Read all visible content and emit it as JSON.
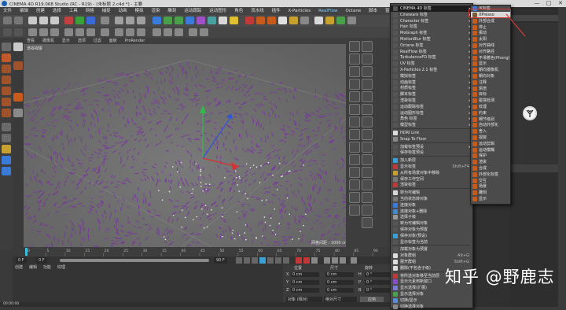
{
  "window": {
    "title": "CINEMA 4D R19.068 Studio (RC - R19) - [未标题 2.c4d *] - 主要",
    "controls": [
      "—",
      "□",
      "✕"
    ]
  },
  "menubar": {
    "items": [
      "文件",
      "编辑",
      "创建",
      "选择",
      "工具",
      "网格",
      "捕捉",
      "动画",
      "模拟",
      "渲染",
      "雕刻",
      "运动跟踪",
      "运动图形",
      "角色",
      "流水线",
      "插件",
      "X-Particles",
      "RealFlow",
      "Octane",
      "脚本",
      "窗口",
      "帮助"
    ]
  },
  "viewport": {
    "header_items": [
      "查看",
      "摄像机",
      "显示",
      "选项",
      "过滤",
      "面板",
      "ProRender"
    ],
    "tag": "透视视图",
    "grid_info": "网格间距 : 1000 cm",
    "scene_color": "#7b2fa5"
  },
  "timeline": {
    "ticks": [
      "0",
      "5",
      "10",
      "15",
      "20",
      "25",
      "30",
      "35",
      "40",
      "45",
      "50",
      "55",
      "60",
      "65",
      "70",
      "75",
      "80",
      "85",
      "90"
    ],
    "frame_start": "0 F",
    "frame_cur": "0 F",
    "frame_end": "90 F"
  },
  "bottom": {
    "menu": [
      "创建",
      "编辑",
      "功能",
      "纹理"
    ],
    "coord_headers": [
      "位置",
      "尺寸",
      "旋转"
    ],
    "rows": [
      {
        "axis": "X",
        "pos": "0 cm",
        "size": "0 cm",
        "rot": "H",
        "rotv": "0 °"
      },
      {
        "axis": "Y",
        "pos": "0 cm",
        "size": "0 cm",
        "rot": "P",
        "rotv": "0 °"
      },
      {
        "axis": "Z",
        "pos": "0 cm",
        "size": "0 cm",
        "rot": "B",
        "rotv": "0 °"
      }
    ],
    "mode": "对象 (相对)",
    "size_mode": "绝对尺寸",
    "apply": "应用"
  },
  "status": "00:00:00",
  "menu_main": {
    "items": [
      {
        "label": "CINEMA 4D 标签",
        "arrow": "▸",
        "highlight": true,
        "color": "#555"
      },
      {
        "label": "Cineware 标签",
        "arrow": "▸",
        "color": "#555"
      },
      {
        "label": "Character 标签",
        "arrow": "▸",
        "color": "#555"
      },
      {
        "label": "Hair 标签",
        "arrow": "▸",
        "color": "#555"
      },
      {
        "label": "MoGraph 标签",
        "arrow": "▸",
        "color": "#555"
      },
      {
        "label": "MotionBlur 标签",
        "arrow": "▸",
        "color": "#555"
      },
      {
        "label": "Octane 标签",
        "arrow": "▸",
        "color": "#555"
      },
      {
        "label": "RealFlow 标签",
        "arrow": "▸",
        "color": "#555"
      },
      {
        "label": "TurbulenceFD 标签",
        "arrow": "▸",
        "color": "#555"
      },
      {
        "label": "UV 标签",
        "arrow": "▸",
        "color": "#555"
      },
      {
        "label": "X-Particles 2.1 标签",
        "arrow": "▸",
        "color": "#555"
      },
      {
        "label": "模拟标签",
        "arrow": "▸",
        "color": "#555"
      },
      {
        "label": "动画标签",
        "arrow": "▸",
        "color": "#555"
      },
      {
        "label": "材质标签",
        "arrow": "▸",
        "color": "#555"
      },
      {
        "label": "脚本标签",
        "arrow": "▸",
        "color": "#555"
      },
      {
        "label": "渲染标签",
        "arrow": "▸",
        "color": "#555"
      },
      {
        "label": "运动跟踪标签",
        "arrow": "▸",
        "color": "#555"
      },
      {
        "label": "运动图形标签",
        "arrow": "▸",
        "color": "#555"
      },
      {
        "label": "角色 标签",
        "arrow": "▸",
        "color": "#555"
      },
      {
        "label": "模型标签",
        "arrow": "▸",
        "color": "#555"
      },
      {
        "label": "HDRI Link",
        "color": "#ddd"
      },
      {
        "label": "Snap To Floor",
        "color": "#888"
      },
      {
        "label": "加载标签预设",
        "arrow": "▸",
        "color": "#555"
      },
      {
        "label": "保存标签预设",
        "color": "#555"
      },
      {
        "label": "加入新层",
        "color": "#3aa0d8"
      },
      {
        "label": "显示标签",
        "shortcut": "Shift+F4",
        "color": "#c03838"
      },
      {
        "label": "从所有场景对象中移除",
        "color": "#c8a030"
      },
      {
        "label": "保存工作空间",
        "color": "#777"
      },
      {
        "label": "渲染标签",
        "color": "#c03838"
      },
      {
        "label": "转为可编辑",
        "color": "#d8d8d8"
      },
      {
        "label": "当前状态转对象",
        "color": "#777"
      },
      {
        "label": "连接对象",
        "color": "#3a7ad8"
      },
      {
        "label": "连接对象+删除",
        "color": "#4488cc"
      },
      {
        "label": "选择子级",
        "color": "#999"
      },
      {
        "label": "转为可编辑对象",
        "color": "#555"
      },
      {
        "label": "保存对象为预置",
        "color": "#555"
      },
      {
        "label": "保存对象(预设)",
        "color": "#3aa0d8"
      },
      {
        "label": "显示标签为当前",
        "color": "#555"
      },
      {
        "label": "加载对象为预置",
        "color": "#555"
      },
      {
        "label": "对象群组",
        "shortcut": "Alt+G",
        "color": "#ddd"
      },
      {
        "label": "展开群组",
        "shortcut": "Shift+G",
        "color": "#ddd"
      },
      {
        "label": "删除(不包含子级)",
        "color": "#ddd"
      },
      {
        "label": "将所选对象移至当前层",
        "color": "#c03838"
      },
      {
        "label": "显示元素到新窗口",
        "color": "#8a4dc8"
      },
      {
        "label": "显示选择(扩展)",
        "color": "#7a7ad8"
      },
      {
        "label": "显示选择对象",
        "color": "#4aa04a"
      },
      {
        "label": "切换/显示",
        "color": "#5a8ad8"
      },
      {
        "label": "切换选择对象",
        "color": "#888"
      }
    ]
  },
  "menu_sub": {
    "items": [
      {
        "label": "XPresso",
        "highlight": true
      },
      {
        "label": "外部合成"
      },
      {
        "label": "停止"
      },
      {
        "label": "振动"
      },
      {
        "label": "太阳"
      },
      {
        "label": "对齐曲线"
      },
      {
        "label": "对齐路径"
      },
      {
        "label": "平滑着色(Phong)"
      },
      {
        "label": "显示"
      },
      {
        "label": "朝向摄像机"
      },
      {
        "label": "朝向对象"
      },
      {
        "label": "注释"
      },
      {
        "label": "烘焙"
      },
      {
        "label": "目标"
      },
      {
        "label": "碰撞检测"
      },
      {
        "label": "纹理"
      },
      {
        "label": "约束"
      },
      {
        "label": "细节级别"
      },
      {
        "label": "自动外部化"
      },
      {
        "label": "舍入"
      },
      {
        "label": "视窗"
      },
      {
        "label": "运动剪辑"
      },
      {
        "label": "运动模糊"
      },
      {
        "label": "保护"
      },
      {
        "label": "渲染"
      },
      {
        "label": "合成"
      },
      {
        "label": "外部化标签"
      },
      {
        "label": "交互"
      },
      {
        "label": "场景"
      },
      {
        "label": "雕刻"
      },
      {
        "label": "显示"
      }
    ],
    "top_item": "IK标签"
  },
  "watermark": "知乎 @野鹿志"
}
